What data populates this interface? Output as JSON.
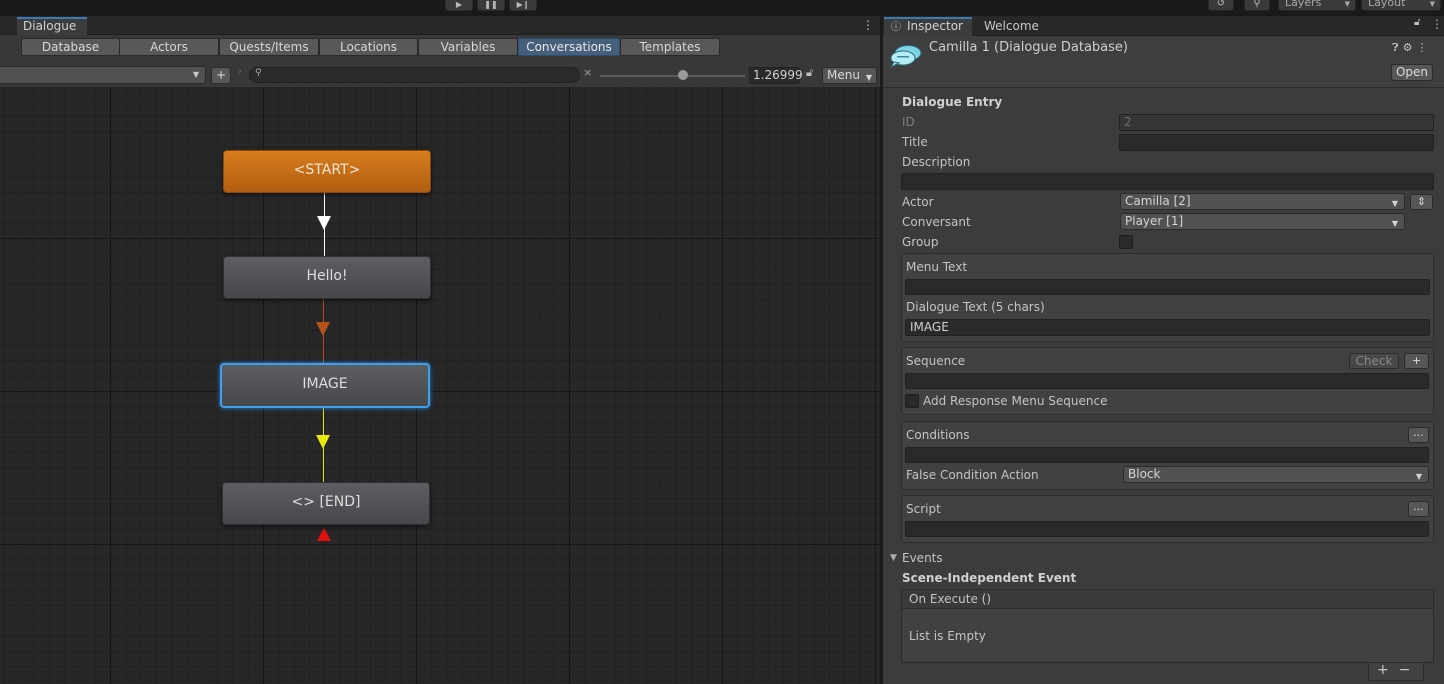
{
  "toolbar": {
    "layers_label": "Layers",
    "layout_label": "Layout"
  },
  "dialogue_window": {
    "tab_label": "Dialogue",
    "db_tabs": [
      {
        "label": "Database",
        "active": false
      },
      {
        "label": "Actors",
        "active": false
      },
      {
        "label": "Quests/Items",
        "active": false
      },
      {
        "label": "Locations",
        "active": false
      },
      {
        "label": "Variables",
        "active": false
      },
      {
        "label": "Conversations",
        "active": true
      },
      {
        "label": "Templates",
        "active": false
      }
    ],
    "add_button": "+",
    "search_placeholder": "",
    "clear_icon": "×",
    "zoom_value": "1.26999",
    "menu_label": "Menu",
    "zoom_fraction": 0.57
  },
  "graph": {
    "nodes": [
      {
        "id": "start",
        "label": "<START>",
        "type": "start"
      },
      {
        "id": "hello",
        "label": "Hello!",
        "type": "normal"
      },
      {
        "id": "image",
        "label": "IMAGE",
        "type": "selected"
      },
      {
        "id": "end",
        "label": "<> [END]",
        "type": "normal"
      }
    ],
    "link_colors": {
      "start_to_hello": "#ffffff",
      "hello_to_image": "#b5531c",
      "image_to_end": "#e8e80a",
      "end_marker": "#e21010"
    }
  },
  "inspector": {
    "tab_label": "Inspector",
    "welcome_tab": "Welcome",
    "object_title": "Camilla 1 (Dialogue Database)",
    "open_button": "Open",
    "section_title": "Dialogue Entry",
    "fields": {
      "id_label": "ID",
      "id_value": "2",
      "title_label": "Title",
      "title_value": "",
      "description_label": "Description",
      "description_value": "",
      "actor_label": "Actor",
      "actor_value": "Camilla [2]",
      "conversant_label": "Conversant",
      "conversant_value": "Player [1]",
      "group_label": "Group",
      "menu_text_label": "Menu Text",
      "menu_text_value": "",
      "dialogue_text_label": "Dialogue Text (5 chars)",
      "dialogue_text_value": "IMAGE",
      "sequence_label": "Sequence",
      "check_button": "Check",
      "sequence_add": "+",
      "sequence_value": "",
      "add_response_label": "Add Response Menu Sequence",
      "conditions_label": "Conditions",
      "conditions_more": "...",
      "conditions_value": "",
      "false_condition_label": "False Condition Action",
      "false_condition_value": "Block",
      "script_label": "Script",
      "script_more": "...",
      "script_value": ""
    },
    "events": {
      "label": "Events",
      "scene_independent": "Scene-Independent Event",
      "on_execute": "On Execute ()",
      "list_empty": "List is Empty",
      "add": "+",
      "remove": "−"
    }
  }
}
